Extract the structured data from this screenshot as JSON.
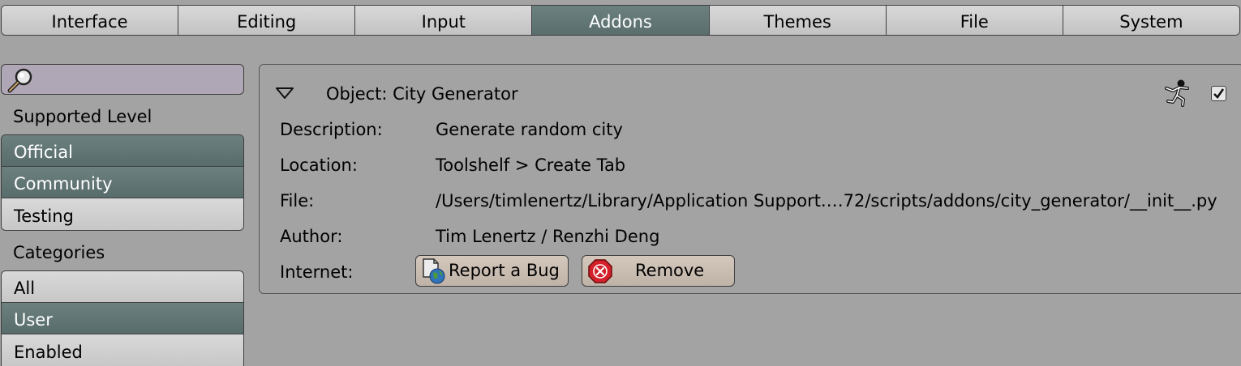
{
  "tabs": [
    {
      "label": "Interface",
      "active": false
    },
    {
      "label": "Editing",
      "active": false
    },
    {
      "label": "Input",
      "active": false
    },
    {
      "label": "Addons",
      "active": true
    },
    {
      "label": "Themes",
      "active": false
    },
    {
      "label": "File",
      "active": false
    },
    {
      "label": "System",
      "active": false
    }
  ],
  "sidebar": {
    "search_value": "",
    "supported_level_label": "Supported Level",
    "supported_levels": [
      {
        "label": "Official",
        "enabled": true
      },
      {
        "label": "Community",
        "enabled": true
      },
      {
        "label": "Testing",
        "enabled": false
      }
    ],
    "categories_label": "Categories",
    "categories": [
      {
        "label": "All",
        "selected": false
      },
      {
        "label": "User",
        "selected": true
      },
      {
        "label": "Enabled",
        "selected": false
      }
    ]
  },
  "addon": {
    "title": "Object: City Generator",
    "enabled": true,
    "rows": [
      {
        "label": "Description:",
        "value": "Generate random city"
      },
      {
        "label": "Location:",
        "value": "Toolshelf > Create Tab"
      },
      {
        "label": "File:",
        "value": "/Users/timlenertz/Library/Application Support.…72/scripts/addons/city_generator/__init__.py"
      },
      {
        "label": "Author:",
        "value": "Tim Lenertz / Renzhi Deng"
      }
    ],
    "internet_label": "Internet:",
    "report_bug_label": "Report a Bug",
    "remove_label": "Remove"
  },
  "colors": {
    "background": "#a3a3a3",
    "active_tab": "#5f7373",
    "search_field": "#b0a7b6",
    "button": "#c9bdb2",
    "remove_icon": "#d4202a"
  },
  "icons": [
    "magnifier-icon",
    "disclosure-triangle-icon",
    "runner-icon",
    "checkbox-check-icon",
    "document-globe-icon",
    "remove-x-icon"
  ]
}
